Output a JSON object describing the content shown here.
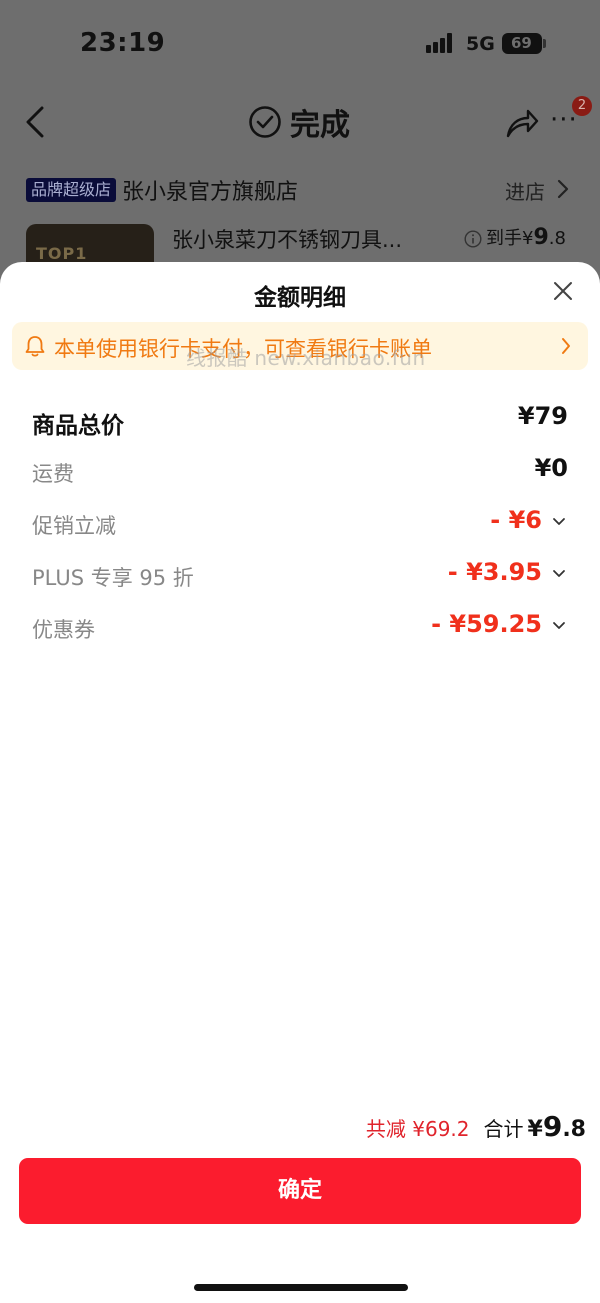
{
  "status_bar": {
    "time": "23:19",
    "network": "5G",
    "battery": "69"
  },
  "nav": {
    "title": "完成",
    "badge_count": "2"
  },
  "store": {
    "badge": "品牌超级店",
    "name": "张小泉官方旗舰店",
    "enter_label": "进店"
  },
  "product": {
    "thumb_text": "TOP1",
    "name": "张小泉菜刀不锈钢刀具...",
    "price_prefix": "到手¥",
    "price_int": "9",
    "price_dec": ".8"
  },
  "sheet": {
    "title": "金额明细",
    "bank_notice": "本单使用银行卡支付，可查看银行卡账单",
    "watermark": "线报酷 new.xianbao.fun",
    "lines": [
      {
        "label": "商品总价",
        "value": "¥79"
      },
      {
        "label": "运费",
        "value": "¥0"
      },
      {
        "label": "促销立减",
        "value": "- ¥6"
      },
      {
        "label": "PLUS 专享 95 折",
        "value": "- ¥3.95"
      },
      {
        "label": "优惠券",
        "value": "- ¥59.25"
      }
    ],
    "saved_total": "共减 ¥69.2",
    "total_label": "合计",
    "total_prefix": "¥",
    "total_int": "9",
    "total_dec": ".8",
    "confirm_label": "确定"
  },
  "colors": {
    "accent_red": "#fb1c2e",
    "discount_red": "#f0301c",
    "notice_orange": "#f07a12",
    "notice_bg": "#fff6e0"
  },
  "icons": [
    "back-icon",
    "check-circle-icon",
    "share-icon",
    "more-icon",
    "chevron-right-icon",
    "info-icon",
    "close-icon",
    "bell-icon",
    "chevron-down-icon"
  ]
}
